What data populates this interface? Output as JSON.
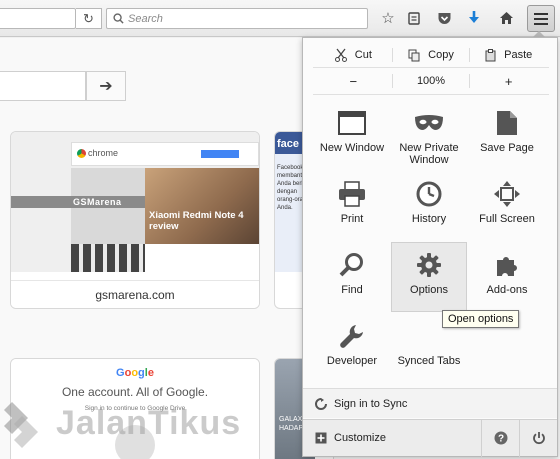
{
  "toolbar": {
    "search_placeholder": "Search",
    "icons": [
      "reload-icon",
      "search-icon",
      "bookmark-star-icon",
      "reading-list-icon",
      "pocket-icon",
      "downloads-icon",
      "home-icon",
      "hamburger-menu-icon"
    ]
  },
  "content": {
    "go_icon": "arrow-right-icon",
    "tiles": [
      {
        "label": "gsmarena.com"
      }
    ],
    "gsm_thumb": {
      "banner_text": "chrome",
      "logo": "GSMarena",
      "headline": "Xiaomi Redmi Note 4 review"
    },
    "fb_thumb": {
      "title": "face",
      "text": "Facebook membantu Anda berbagi dengan orang-orang Anda."
    },
    "google_thumb": {
      "logo": [
        "G",
        "o",
        "o",
        "g",
        "l",
        "e"
      ],
      "heading": "One account. All of Google.",
      "sub": "Sign in to continue to Google Drive"
    },
    "tile5_caption": "GALAXY HADAP"
  },
  "watermark": {
    "text": "JalanTikus"
  },
  "menu": {
    "edit": {
      "cut": "Cut",
      "copy": "Copy",
      "paste": "Paste"
    },
    "zoom": {
      "minus": "−",
      "level": "100%",
      "plus": "+"
    },
    "items": [
      {
        "label": "New Window"
      },
      {
        "label": "New Private Window"
      },
      {
        "label": "Save Page"
      },
      {
        "label": "Print"
      },
      {
        "label": "History"
      },
      {
        "label": "Full Screen"
      },
      {
        "label": "Find"
      },
      {
        "label": "Options"
      },
      {
        "label": "Add-ons"
      },
      {
        "label": "Developer"
      },
      {
        "label": "Synced Tabs"
      }
    ],
    "tooltip": "Open options",
    "sign_in": "Sign in to Sync",
    "customize": "Customize",
    "colors": {
      "accent": "#0a84ff",
      "gear": "#4a6a8a",
      "pocket": "#ef4056"
    }
  }
}
